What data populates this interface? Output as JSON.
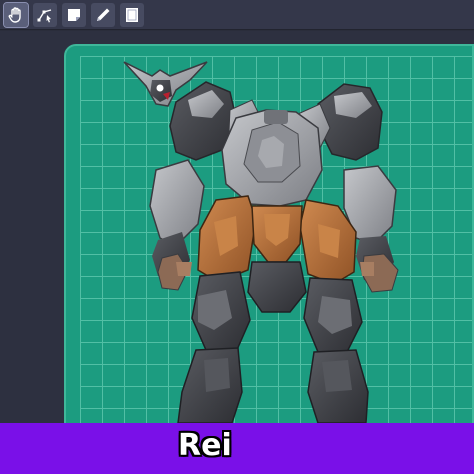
{
  "toolbar": {
    "tools": [
      {
        "icon": "hand-icon",
        "active": true
      },
      {
        "icon": "node-edit-icon",
        "active": false
      },
      {
        "icon": "sticky-note-icon",
        "active": false
      },
      {
        "icon": "pen-icon",
        "active": false
      },
      {
        "icon": "page-icon",
        "active": false
      }
    ]
  },
  "canvas": {
    "mat_color": "#1c9c80",
    "grid_color": "#5cc6ac",
    "armor_gray": "#9a9ca1",
    "armor_orange": "#b8713b"
  },
  "caption": {
    "text": "Rei",
    "bar_color": "#7a10e8"
  }
}
